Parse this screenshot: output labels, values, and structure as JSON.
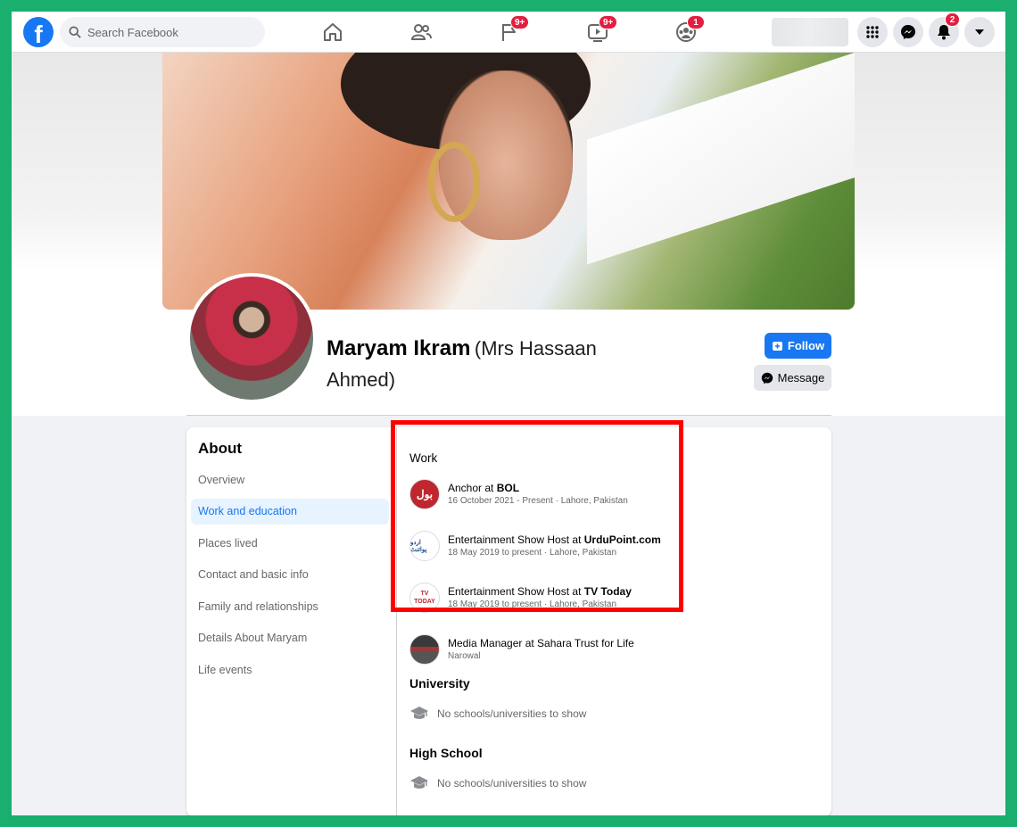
{
  "topbar": {
    "search_placeholder": "Search Facebook",
    "badges": {
      "pages": "9+",
      "watch": "9+",
      "groups": "1",
      "notifications": "2"
    }
  },
  "profile": {
    "name": "Maryam Ikram",
    "alternate_name": "(Mrs Hassaan Ahmed)",
    "follow_label": "Follow",
    "message_label": "Message"
  },
  "about": {
    "title": "About",
    "menu": [
      {
        "label": "Overview",
        "active": false
      },
      {
        "label": "Work and education",
        "active": true
      },
      {
        "label": "Places lived",
        "active": false
      },
      {
        "label": "Contact and basic info",
        "active": false
      },
      {
        "label": "Family and relationships",
        "active": false
      },
      {
        "label": "Details About Maryam",
        "active": false
      },
      {
        "label": "Life events",
        "active": false
      }
    ]
  },
  "work": {
    "title": "Work",
    "items": [
      {
        "role": "Anchor at ",
        "org": "BOL",
        "detail": "16 October 2021 - Present · Lahore, Pakistan",
        "logo_text": "بول"
      },
      {
        "role": "Entertainment Show Host at ",
        "org": "UrduPoint.com",
        "detail": "18 May 2019 to present · Lahore, Pakistan",
        "logo_text": "اردو پوائنٹ"
      },
      {
        "role": "Entertainment Show Host at ",
        "org": "TV Today",
        "detail": "18 May 2019 to present · Lahore, Pakistan",
        "logo_text": "TV TODAY"
      },
      {
        "role": "Media Manager at Sahara Trust for Life",
        "org": "",
        "detail": "Narowal",
        "logo_text": ""
      }
    ]
  },
  "university": {
    "title": "University",
    "empty_text": "No schools/universities to show"
  },
  "high_school": {
    "title": "High School",
    "empty_text": "No schools/universities to show"
  },
  "colors": {
    "accent": "#1877f2",
    "highlight": "#ff0000",
    "frame": "#1aae6f",
    "badge": "#e41e3f"
  }
}
